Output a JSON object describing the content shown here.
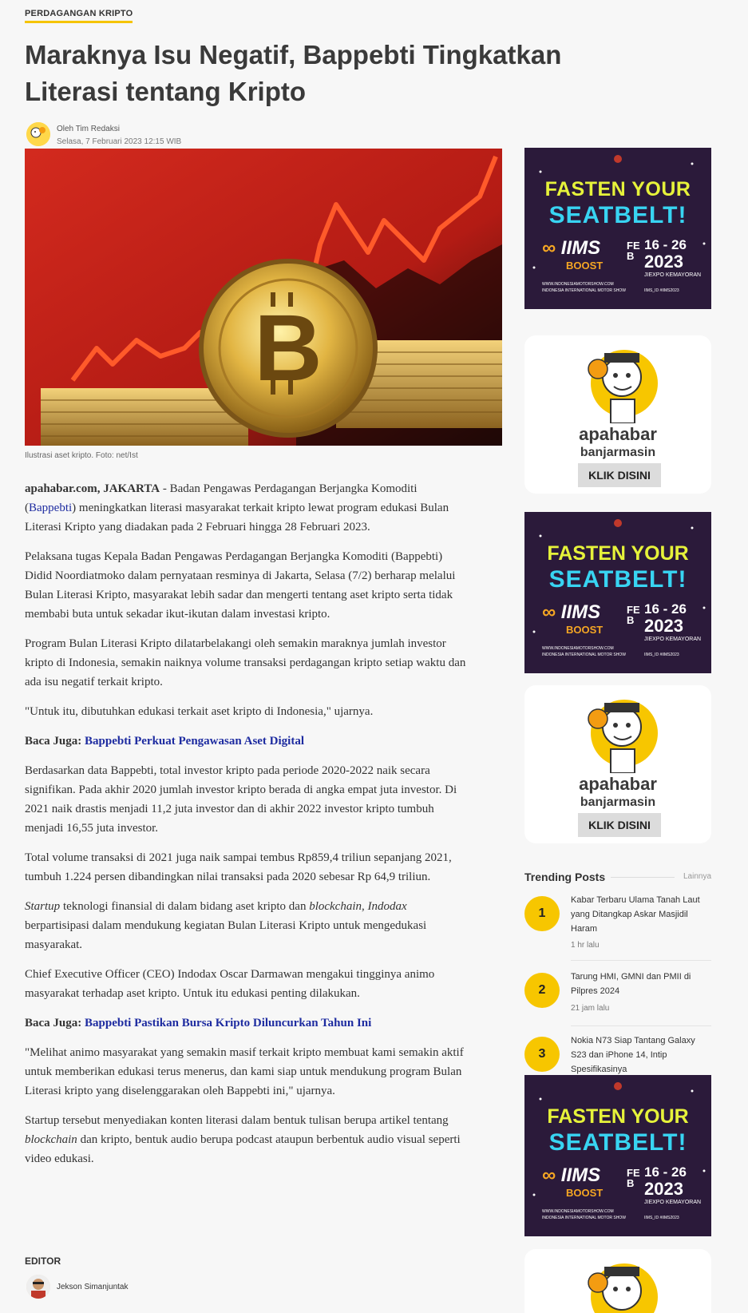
{
  "category": "PERDAGANGAN KRIPTO",
  "title": "Maraknya Isu Negatif, Bappebti Tingkatkan Literasi tentang Kripto",
  "author": {
    "name": "Oleh Tim Redaksi",
    "date": "Selasa, 7 Februari 2023 12:15 WIB"
  },
  "image_caption": "Ilustrasi aset kripto. Foto: net/Ist",
  "article": {
    "p1_source": "apahabar.com, JAKARTA",
    "p1_a": " - Badan Pengawas Perdagangan Berjangka Komoditi (",
    "p1_link": "Bappebti",
    "p1_b": ") meningkatkan literasi masyarakat terkait kripto lewat program edukasi Bulan Literasi Kripto yang diadakan pada 2 Februari hingga 28 Februari 2023.",
    "p2": "Pelaksana tugas Kepala Badan Pengawas Perdagangan Berjangka Komoditi (Bappebti) Didid Noordiatmoko dalam pernyataan resminya di Jakarta, Selasa (7/2) berharap melalui Bulan Literasi Kripto, masyarakat lebih sadar dan mengerti tentang aset kripto serta tidak membabi buta untuk sekadar ikut-ikutan dalam investasi kripto.",
    "p3": "Program Bulan Literasi Kripto dilatarbelakangi oleh semakin maraknya jumlah investor kripto di Indonesia, semakin naiknya volume transaksi perdagangan kripto setiap waktu dan ada isu negatif terkait kripto.",
    "p4": "\"Untuk itu, dibutuhkan edukasi terkait aset kripto di Indonesia,\" ujarnya.",
    "read_also_label": "Baca Juga: ",
    "read_also_1": "Bappebti Perkuat Pengawasan Aset Digital",
    "p5": "Berdasarkan data Bappebti, total investor kripto pada periode 2020-2022 naik secara signifikan. Pada akhir 2020 jumlah investor kripto berada di angka empat juta investor. Di  2021 naik drastis menjadi 11,2 juta investor dan di akhir 2022 investor kripto tumbuh menjadi 16,55 juta investor.",
    "p6": "Total volume transaksi di  2021 juga naik sampai tembus Rp859,4 triliun sepanjang 2021, tumbuh 1.224 persen dibandingkan nilai transaksi pada 2020 sebesar Rp 64,9 triliun.",
    "p7_i1": "Startup",
    "p7_a": " teknologi finansial di dalam bidang aset kripto dan ",
    "p7_i2": "blockchain",
    "p7_sep": ", ",
    "p7_i3": "Indodax",
    "p7_b": " berpartisipasi dalam mendukung kegiatan Bulan Literasi Kripto untuk mengedukasi masyarakat.",
    "p8": "Chief Executive Officer (CEO) Indodax Oscar Darmawan mengakui tingginya animo masyarakat terhadap aset kripto. Untuk itu edukasi penting dilakukan.",
    "read_also_2": "Bappebti Pastikan Bursa Kripto Diluncurkan Tahun Ini",
    "p9": "\"Melihat animo masyarakat yang semakin masif terkait kripto membuat kami semakin aktif untuk memberikan edukasi terus menerus, dan kami siap untuk mendukung program Bulan Literasi kripto yang diselenggarakan oleh Bappebti ini,\" ujarnya.",
    "p10_a": "Startup tersebut menyediakan konten literasi dalam bentuk tulisan berupa artikel tentang ",
    "p10_i": "blockchain",
    "p10_b": " dan kripto, bentuk audio berupa podcast ataupun berbentuk audio visual seperti video edukasi."
  },
  "editor": {
    "label": "EDITOR",
    "name": "Jekson Simanjuntak"
  },
  "ads": {
    "seatbelt": {
      "line1": "FASTEN YOUR",
      "line2": "SEATBELT!",
      "logo": "IIMS",
      "logo_sub": "BOOST",
      "month": "FEB",
      "dates": "16 - 26",
      "year": "2023",
      "venue": "JIEXPO KEMAYORAN",
      "url": "WWW.INDONESIAMOTORSHOW.COM",
      "footer": "INDONESIA INTERNATIONAL MOTOR SHOW",
      "handle": "IIMS_ID #IIMS2023",
      "colors": {
        "bg": "#2b1a3a",
        "neon_yellow": "#e6f23a",
        "neon_cyan": "#38d4f2",
        "logo_orange": "#f5a623"
      }
    },
    "apahabar": {
      "brand1": "apahabar",
      "brand2": "banjarmasin",
      "cta": "KLIK DISINI"
    }
  },
  "trending": {
    "heading": "Trending Posts",
    "more": "Lainnya",
    "items": [
      {
        "rank": "1",
        "title": "Kabar Terbaru Ulama Tanah Laut yang Ditangkap Askar Masjidil Haram",
        "time": "1 hr lalu"
      },
      {
        "rank": "2",
        "title": "Tarung HMI, GMNI dan PMII di Pilpres 2024",
        "time": "21 jam lalu"
      },
      {
        "rank": "3",
        "title": "Nokia N73 Siap Tantang Galaxy S23 dan iPhone 14, Intip Spesifikasinya",
        "time": ""
      }
    ]
  },
  "colors": {
    "accent": "#f5c400",
    "link": "#1d2ba0",
    "trend_badge": "#f7c600"
  }
}
